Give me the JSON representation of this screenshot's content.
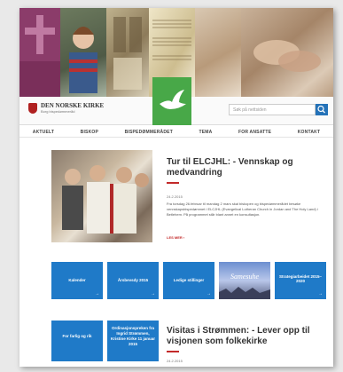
{
  "header": {
    "logo_text": "DEN NORSKE KIRKE",
    "logo_subtitle": "Borg bispedømmeråd",
    "search_placeholder": "Søk på nettsiden"
  },
  "nav": {
    "items": [
      "AKTUELT",
      "BISKOP",
      "BISPEDØMMERÅDET",
      "TEMA",
      "FOR ANSATTE",
      "KONTAKT"
    ]
  },
  "article1": {
    "title": "Tur til ELCJHL: - Vennskap og medvandring",
    "date": "24.2.2015",
    "body": "Fra torsdag 26.februar til mandag 2 mars skal biskopen og bispedømmerådet besøke vennskapsbispedømmet i ELCJHL (Evangelical Lutheran Church in Jordan and The Holy Land) i Betlehem. På programmet står blant annet en konsultasjon.",
    "more": "LES MER"
  },
  "tiles": [
    {
      "label": "Kalender"
    },
    {
      "label": "Årsbevsdy 2015"
    },
    {
      "label": "Ledige stillinger"
    },
    {
      "label": "Samesuhe",
      "type": "picture"
    },
    {
      "label": "Strategiarbeidet 2015–2020"
    }
  ],
  "bottom_tiles": [
    {
      "label": "For farlig og rik"
    },
    {
      "label": "Ordinasjonspreken fra Ingrid Strømmen, Kristine Kirke 11 januar 2015"
    }
  ],
  "article2": {
    "title": "Visitas i Strømmen: - Lever opp til visjonen som folkekirke",
    "date": "24.2.2015"
  },
  "colors": {
    "accent_blue": "#1f7ac8",
    "accent_red": "#c32a2a",
    "accent_green": "#48a848"
  }
}
